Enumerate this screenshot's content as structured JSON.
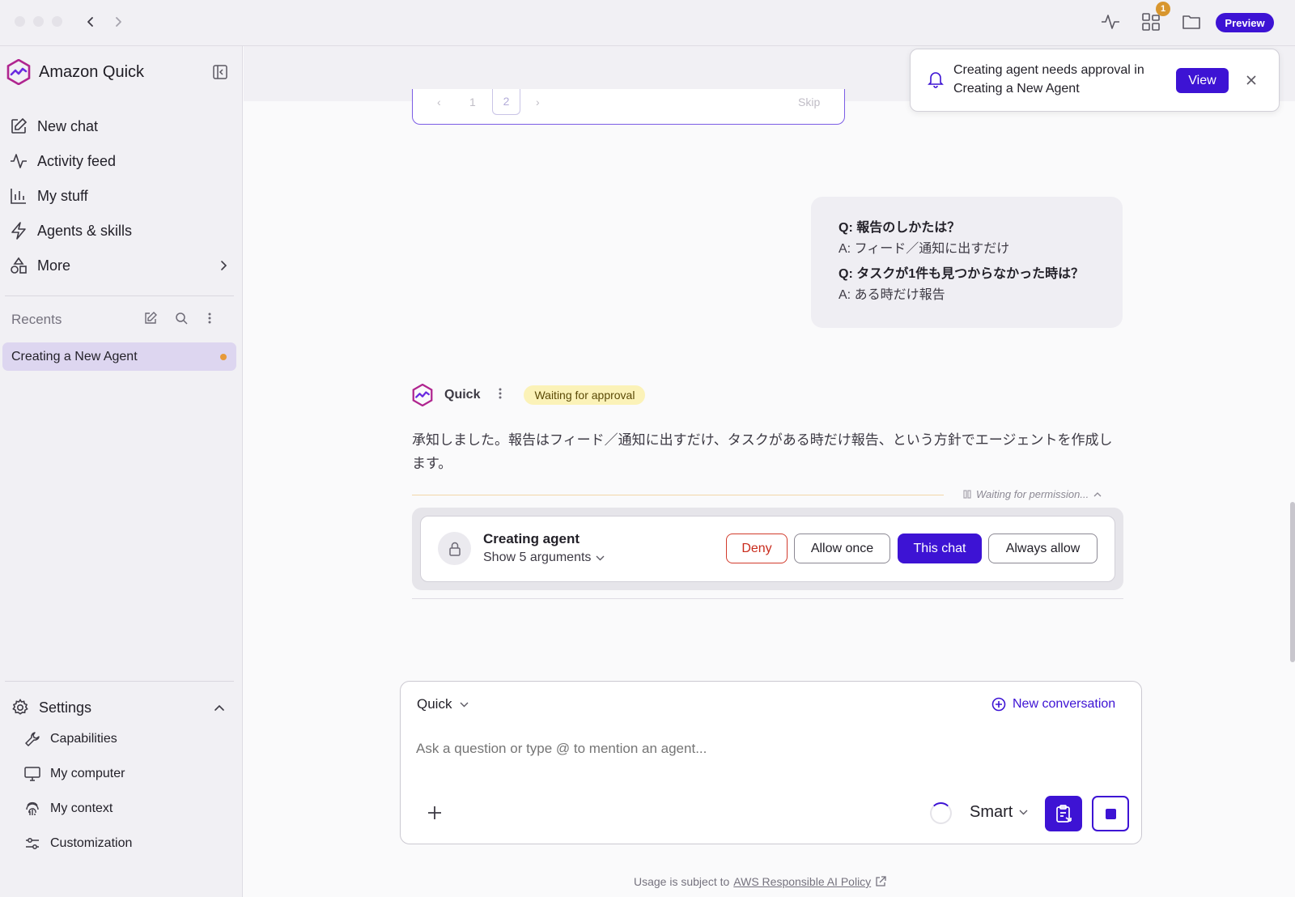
{
  "colors": {
    "accent": "#3d13d4",
    "deny": "#c92b1c",
    "badge": "#d8962e",
    "waiting_bg": "#fbf2b8"
  },
  "topbar": {
    "notification_count": "1",
    "preview_label": "Preview",
    "icons": [
      "back-arrow-icon",
      "forward-arrow-icon",
      "activity-icon",
      "widgets-icon",
      "folder-icon"
    ]
  },
  "sidebar": {
    "brand": "Amazon Quick",
    "nav": [
      {
        "label": "New chat",
        "icon": "new-chat-icon"
      },
      {
        "label": "Activity feed",
        "icon": "activity-icon"
      },
      {
        "label": "My stuff",
        "icon": "chart-icon"
      },
      {
        "label": "Agents & skills",
        "icon": "lightning-icon"
      },
      {
        "label": "More",
        "icon": "shapes-icon"
      }
    ],
    "recents_label": "Recents",
    "recent_items": [
      {
        "label": "Creating a New Agent"
      }
    ],
    "settings_label": "Settings",
    "settings_items": [
      {
        "label": "Capabilities",
        "icon": "wrench-icon"
      },
      {
        "label": "My computer",
        "icon": "monitor-icon"
      },
      {
        "label": "My context",
        "icon": "fingerprint-icon"
      },
      {
        "label": "Customization",
        "icon": "sliders-icon"
      }
    ]
  },
  "toast": {
    "message": "Creating agent needs approval in Creating a New Agent",
    "view_label": "View"
  },
  "pager": {
    "pages": [
      "1",
      "2"
    ],
    "current": "2",
    "skip_label": "Skip"
  },
  "user_message": {
    "q1": "Q: 報告のしかたは？",
    "a1": "A: フィード／通知に出すだけ",
    "q2": "Q: タスクが1件も見つからなかった時は？",
    "a2": "A: ある時だけ報告"
  },
  "assistant": {
    "name": "Quick",
    "status": "Waiting for approval",
    "text": "承知しました。報告はフィード／通知に出すだけ、タスクがある時だけ報告、という方針でエージェントを作成します。",
    "waiting_text": "Waiting for permission..."
  },
  "permission": {
    "title": "Creating agent",
    "args_label": "Show 5 arguments",
    "buttons": {
      "deny": "Deny",
      "allow_once": "Allow once",
      "this_chat": "This chat",
      "always_allow": "Always allow"
    }
  },
  "composer": {
    "agent": "Quick",
    "new_conversation": "New conversation",
    "placeholder": "Ask a question or type @ to mention an agent...",
    "mode": "Smart"
  },
  "footer": {
    "prefix": "Usage is subject to",
    "link": "AWS Responsible AI Policy"
  }
}
